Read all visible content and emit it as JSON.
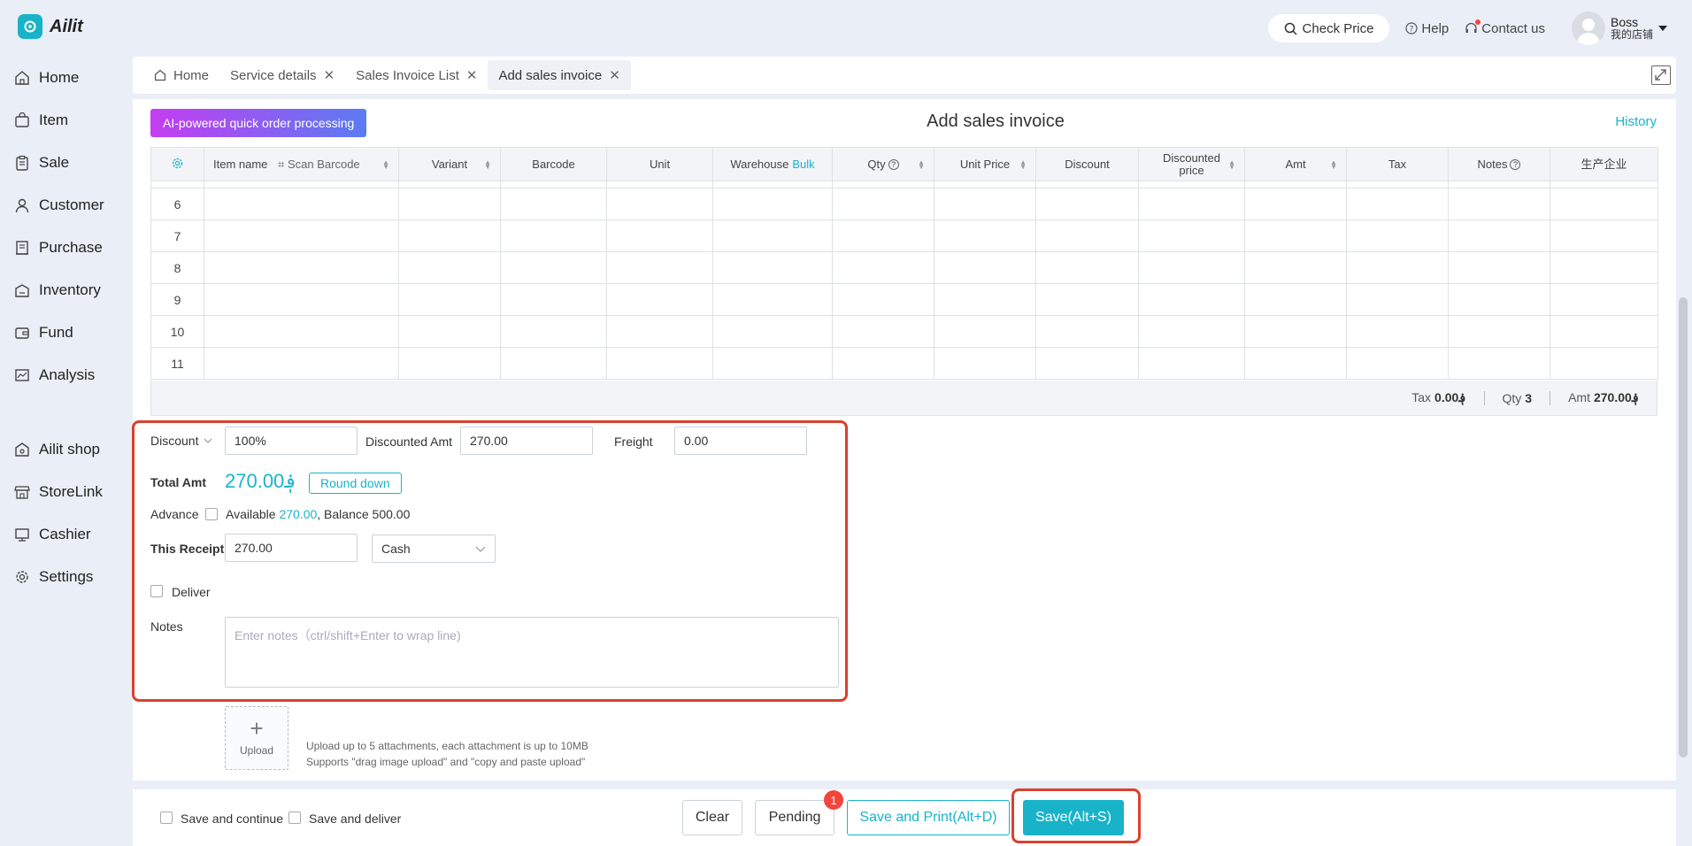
{
  "app": {
    "name": "Ailit",
    "brand_color": "#19b3c9"
  },
  "topbar": {
    "check_price": "Check Price",
    "help": "Help",
    "contact": "Contact us",
    "user_name": "Boss",
    "store_name": "我的店铺"
  },
  "sidebar": {
    "items": [
      {
        "label": "Home",
        "icon": "home-icon"
      },
      {
        "label": "Item",
        "icon": "bag-icon"
      },
      {
        "label": "Sale",
        "icon": "clipboard-icon"
      },
      {
        "label": "Customer",
        "icon": "person-icon"
      },
      {
        "label": "Purchase",
        "icon": "receipt-icon"
      },
      {
        "label": "Inventory",
        "icon": "warehouse-icon"
      },
      {
        "label": "Fund",
        "icon": "wallet-icon"
      },
      {
        "label": "Analysis",
        "icon": "chart-icon"
      },
      {
        "label": "Ailit shop",
        "icon": "shop-icon"
      },
      {
        "label": "StoreLink",
        "icon": "store-icon"
      },
      {
        "label": "Cashier",
        "icon": "monitor-icon"
      },
      {
        "label": "Settings",
        "icon": "gear-icon"
      }
    ]
  },
  "tabs": [
    {
      "label": "Home"
    },
    {
      "label": "Service details"
    },
    {
      "label": "Sales Invoice List"
    },
    {
      "label": "Add sales invoice"
    }
  ],
  "header": {
    "ai_button": "AI-powered quick order processing",
    "title": "Add sales invoice",
    "history": "History"
  },
  "table": {
    "columns": {
      "item_name": "Item name",
      "scan_barcode": "Scan Barcode",
      "variant": "Variant",
      "barcode": "Barcode",
      "unit": "Unit",
      "warehouse": "Warehouse",
      "bulk": "Bulk",
      "qty": "Qty",
      "unit_price": "Unit Price",
      "discount": "Discount",
      "discounted_price": "Discounted price",
      "amt": "Amt",
      "tax": "Tax",
      "notes": "Notes",
      "manufacturer": "生产企业"
    },
    "rows": [
      "6",
      "7",
      "8",
      "9",
      "10",
      "11"
    ]
  },
  "totals": {
    "tax_label": "Tax",
    "tax_value": "0.00؋",
    "qty_label": "Qty",
    "qty_value": "3",
    "amt_label": "Amt",
    "amt_value": "270.00؋"
  },
  "form": {
    "discount_label": "Discount",
    "discount_value": "100%",
    "discounted_amt_label": "Discounted Amt",
    "discounted_amt_value": "270.00",
    "freight_label": "Freight",
    "freight_value": "0.00",
    "total_amt_label": "Total Amt",
    "total_amt_value": "270.00؋",
    "round_down": "Round down",
    "advance_label": "Advance",
    "available_label": "Available",
    "available_value": "270.00",
    "balance_text": ", Balance 500.00",
    "receipt_label": "This Receipt",
    "receipt_value": "270.00",
    "payment_method": "Cash",
    "deliver_label": "Deliver",
    "notes_label": "Notes",
    "notes_placeholder": "Enter notes（ctrl/shift+Enter to wrap line)",
    "upload_label": "Upload",
    "upload_hint_1": "Upload up to 5 attachments, each attachment is up to 10MB",
    "upload_hint_2": "Supports \"drag image upload\" and \"copy and paste upload\""
  },
  "bottom": {
    "save_continue": "Save and continue",
    "save_deliver": "Save and deliver",
    "clear": "Clear",
    "pending": "Pending",
    "pending_badge": "1",
    "save_print": "Save and Print(Alt+D)",
    "save": "Save(Alt+S)"
  }
}
